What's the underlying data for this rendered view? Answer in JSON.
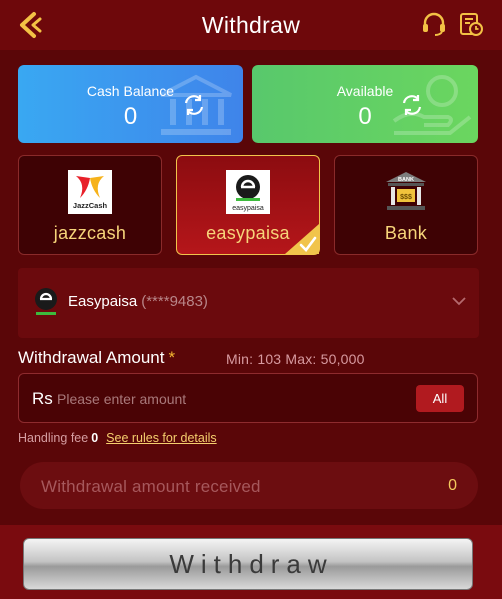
{
  "header": {
    "title": "Withdraw",
    "back_icon": "back-chevron-icon",
    "support_icon": "headset-icon",
    "history_icon": "record-history-icon"
  },
  "balances": {
    "cash": {
      "label": "Cash Balance",
      "value": "0"
    },
    "available": {
      "label": "Available",
      "value": "0"
    }
  },
  "methods": [
    {
      "label": "jazzcash",
      "logo_text": "JazzCash",
      "selected": false
    },
    {
      "label": "easypaisa",
      "logo_text": "easypaisa",
      "selected": true
    },
    {
      "label": "Bank",
      "logo_text": "BANK",
      "selected": false
    }
  ],
  "account": {
    "name": "Easypaisa",
    "number": "(****9483)"
  },
  "amount": {
    "label": "Withdrawal Amount",
    "required_mark": "*",
    "range": "Min: 103 Max: 50,000",
    "currency": "Rs",
    "placeholder": "Please enter amount",
    "all_label": "All"
  },
  "fee": {
    "label": "Handling fee",
    "value": "0",
    "rules_link": "See rules for details"
  },
  "received": {
    "label": "Withdrawal amount received",
    "value": "0"
  },
  "submit": {
    "label": "Withdraw"
  },
  "colors": {
    "background": "#5a0608",
    "header": "#6e080b",
    "accent_gold": "#f7d57a",
    "cash_card": "#3fa0ef",
    "available_card": "#5dcc6a",
    "selected_border": "#f1c44b",
    "all_button": "#b11a1f"
  }
}
